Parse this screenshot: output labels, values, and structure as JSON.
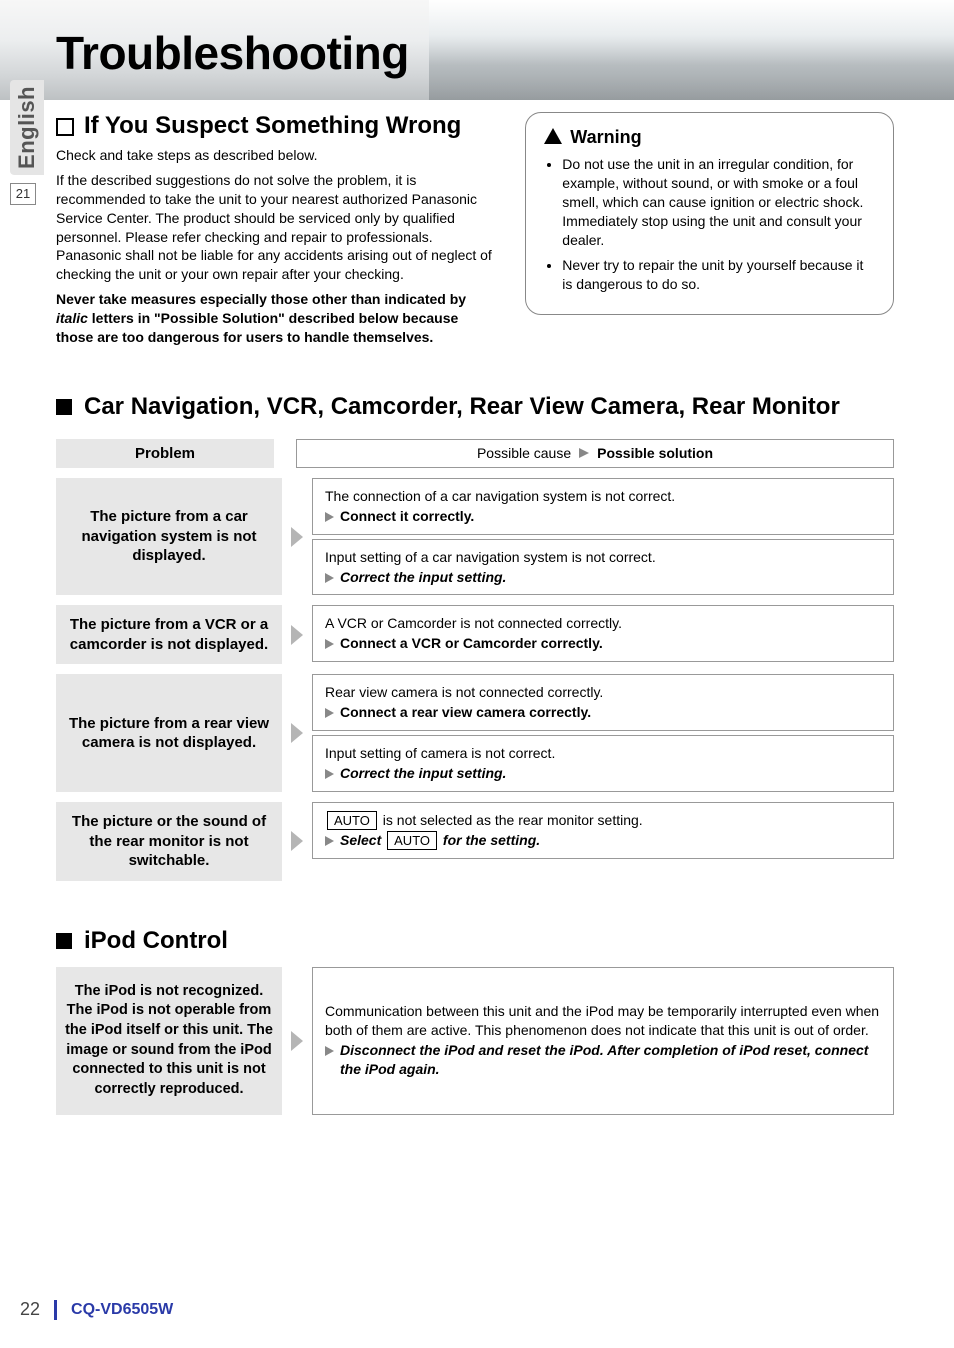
{
  "side": {
    "language": "English",
    "section_num": "21"
  },
  "title": "Troubleshooting",
  "suspect": {
    "heading": "If You Suspect Something Wrong",
    "line1": "Check and take steps as described below.",
    "para": "If the described suggestions do not solve the problem, it is recommended to take the unit to your nearest authorized Panasonic Service Center. The product should be serviced only by qualified personnel. Please refer checking and repair to professionals. Panasonic shall not be liable for any accidents arising out of neglect of checking the unit or your own repair after your checking.",
    "bold_prefix": "Never take measures especially those other than indicated by ",
    "bold_italic": "italic",
    "bold_suffix": " letters in \"Possible Solution\" described below because those are too dangerous for users to handle themselves."
  },
  "warning": {
    "heading": "Warning",
    "items": [
      "Do not use the unit in an irregular condition, for example, without sound, or with smoke or a foul smell, which can cause ignition or electric shock. Immediately stop using the unit and consult your dealer.",
      "Never try to repair the unit by yourself because it is dangerous to do so."
    ]
  },
  "nav_section": {
    "heading": "Car Navigation, VCR, Camcorder, Rear View Camera, Rear Monitor",
    "col_problem": "Problem",
    "col_cause": "Possible cause",
    "col_solution": "Possible solution",
    "rows": [
      {
        "problem": "The picture from a car navigation system is not displayed.",
        "cells": [
          {
            "cause": "The connection of a car navigation system is not correct.",
            "solution": "Connect it correctly.",
            "italic": false
          },
          {
            "cause": "Input setting of a car navigation system is not correct.",
            "solution": "Correct the input setting.",
            "italic": true
          }
        ]
      },
      {
        "problem": "The picture from a VCR or a camcorder is not displayed.",
        "cells": [
          {
            "cause": "A VCR or Camcorder is not connected correctly.",
            "solution": "Connect a VCR or Camcorder correctly.",
            "italic": false
          }
        ]
      },
      {
        "problem": "The picture from a rear view camera is not displayed.",
        "cells": [
          {
            "cause": "Rear view camera is not connected correctly.",
            "solution": "Connect a rear view camera correctly.",
            "italic": false
          },
          {
            "cause": "Input setting of camera is not correct.",
            "solution": "Correct the input setting.",
            "italic": true
          }
        ]
      },
      {
        "problem": "The picture or the sound of the rear monitor is not switchable.",
        "auto_row": {
          "chip": "AUTO",
          "cause_pre": " is not selected as the rear monitor setting.",
          "sol_pre": "Select ",
          "sol_post": " for the setting."
        }
      }
    ]
  },
  "ipod_section": {
    "heading": "iPod Control",
    "problem": "The iPod is not recognized. The iPod is not operable from the iPod itself or this unit. The image or sound from the iPod connected to this unit is not correctly reproduced.",
    "cause": "Communication between this unit and the iPod may be temporarily interrupted even when both of them are active. This phenomenon does not indicate that this unit is out of order.",
    "solution": "Disconnect the iPod and reset the iPod. After completion of iPod reset, connect the iPod again."
  },
  "footer": {
    "page": "22",
    "model": "CQ-VD6505W"
  }
}
